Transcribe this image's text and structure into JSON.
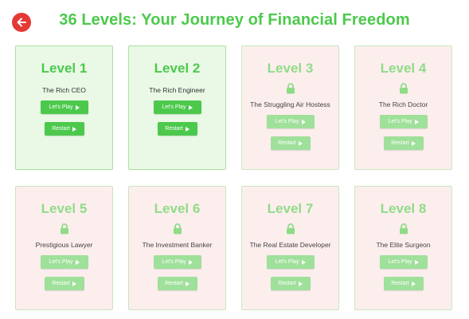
{
  "header": {
    "title": "36 Levels: Your Journey of Financial Freedom"
  },
  "colors": {
    "accent": "#4cc94c",
    "back_button": "#e53935",
    "unlocked_card_bg": "#e9f9e6",
    "locked_card_bg": "#fdeeee"
  },
  "icons": {
    "back": "arrow-left-icon",
    "lock": "lock-icon",
    "play": "play-triangle-icon"
  },
  "levels": [
    {
      "title": "Level 1",
      "name": "The Rich CEO",
      "locked": false,
      "play_label": "Let's Play",
      "restart_label": "Restart"
    },
    {
      "title": "Level 2",
      "name": "The Rich Engineer",
      "locked": false,
      "play_label": "Let's Play",
      "restart_label": "Restart"
    },
    {
      "title": "Level 3",
      "name": "The Struggling Air Hostess",
      "locked": true,
      "play_label": "Let's Play",
      "restart_label": "Restart"
    },
    {
      "title": "Level 4",
      "name": "The Rich Doctor",
      "locked": true,
      "play_label": "Let's Play",
      "restart_label": "Restart"
    },
    {
      "title": "Level 5",
      "name": "Prestigious Lawyer",
      "locked": true,
      "play_label": "Let's Play",
      "restart_label": "Restart"
    },
    {
      "title": "Level 6",
      "name": "The Investment Banker",
      "locked": true,
      "play_label": "Let's Play",
      "restart_label": "Restart"
    },
    {
      "title": "Level 7",
      "name": "The Real Estate Developer",
      "locked": true,
      "play_label": "Let's Play",
      "restart_label": "Restart"
    },
    {
      "title": "Level 8",
      "name": "The Elite Surgeon",
      "locked": true,
      "play_label": "Let's Play",
      "restart_label": "Restart"
    }
  ]
}
